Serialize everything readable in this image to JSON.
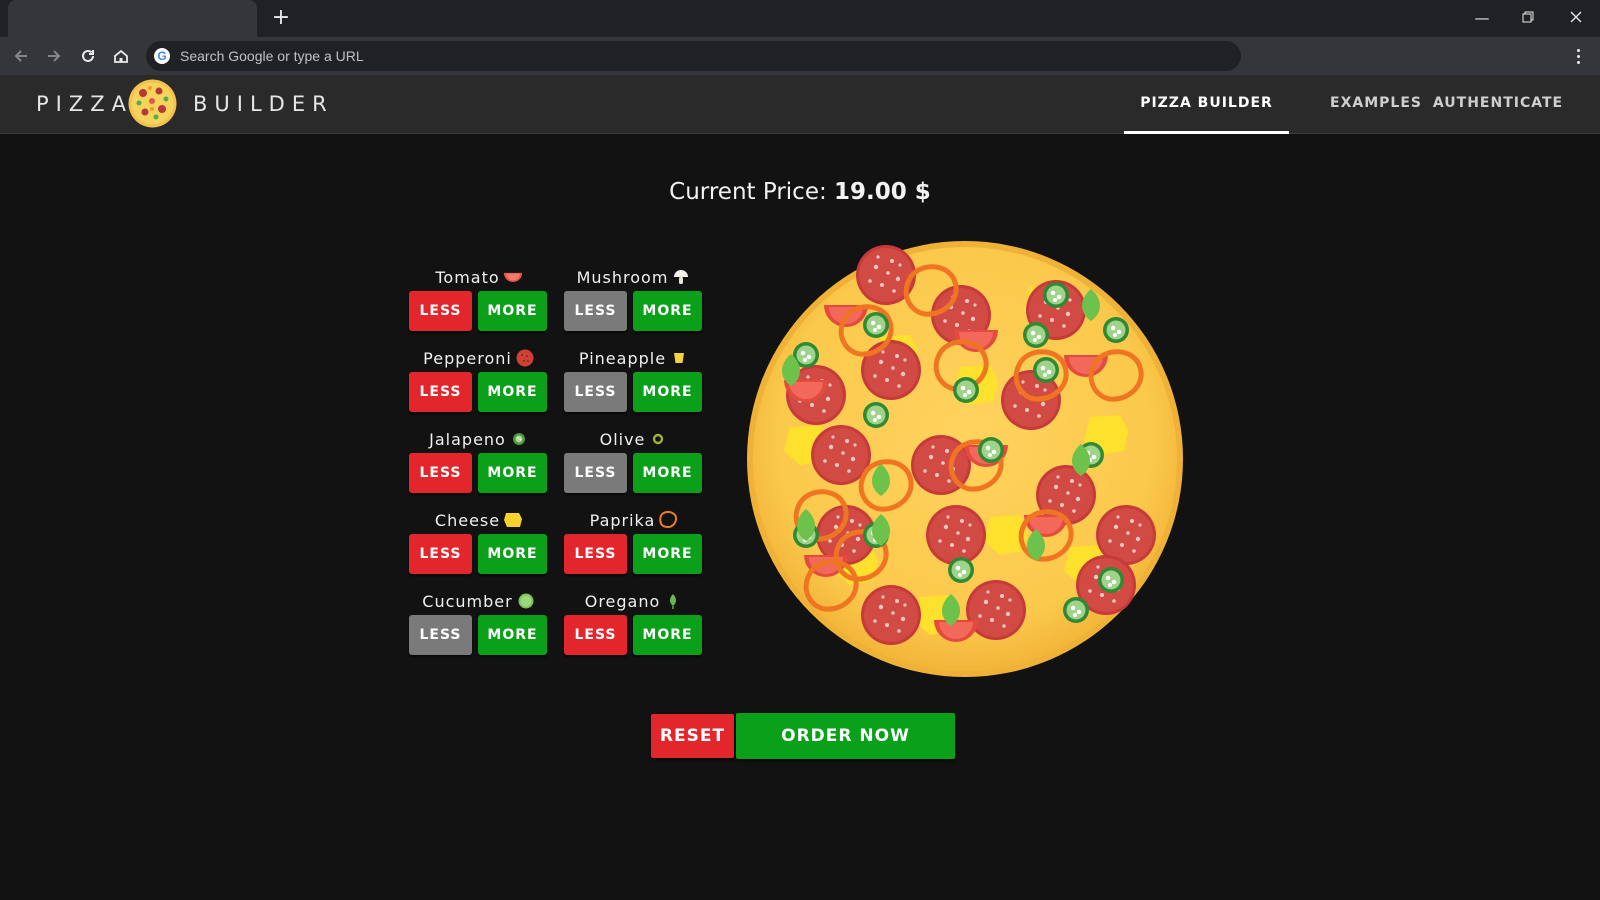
{
  "browser": {
    "new_tab_icon": "plus-icon",
    "omnibox_placeholder": "Search Google or type a URL",
    "window_controls": [
      "minimize-icon",
      "restore-icon",
      "close-icon"
    ],
    "nav_icons": [
      "back-icon",
      "forward-icon",
      "reload-icon",
      "home-icon"
    ]
  },
  "header": {
    "brand_left": "PIZZA",
    "brand_right": "BUILDER",
    "nav": [
      {
        "label": "PIZZA BUILDER",
        "active": true
      },
      {
        "label": "EXAMPLES",
        "active": false
      },
      {
        "label": "AUTHENTICATE",
        "active": false
      }
    ]
  },
  "price": {
    "label": "Current Price:",
    "value": "19.00 $"
  },
  "ingredients": [
    {
      "name": "Tomato",
      "icon": "tomato-icon",
      "less_label": "LESS",
      "more_label": "MORE",
      "less_active": true
    },
    {
      "name": "Mushroom",
      "icon": "mushroom-icon",
      "less_label": "LESS",
      "more_label": "MORE",
      "less_active": false
    },
    {
      "name": "Pepperoni",
      "icon": "pepperoni-icon",
      "less_label": "LESS",
      "more_label": "MORE",
      "less_active": true
    },
    {
      "name": "Pineapple",
      "icon": "pineapple-icon",
      "less_label": "LESS",
      "more_label": "MORE",
      "less_active": false
    },
    {
      "name": "Jalapeno",
      "icon": "jalapeno-icon",
      "less_label": "LESS",
      "more_label": "MORE",
      "less_active": true
    },
    {
      "name": "Olive",
      "icon": "olive-icon",
      "less_label": "LESS",
      "more_label": "MORE",
      "less_active": false
    },
    {
      "name": "Cheese",
      "icon": "cheese-icon",
      "less_label": "LESS",
      "more_label": "MORE",
      "less_active": true
    },
    {
      "name": "Paprika",
      "icon": "paprika-icon",
      "less_label": "LESS",
      "more_label": "MORE",
      "less_active": true
    },
    {
      "name": "Cucumber",
      "icon": "cucumber-icon",
      "less_label": "LESS",
      "more_label": "MORE",
      "less_active": false
    },
    {
      "name": "Oregano",
      "icon": "oregano-icon",
      "less_label": "LESS",
      "more_label": "MORE",
      "less_active": true
    }
  ],
  "actions": {
    "reset_label": "RESET",
    "order_label": "ORDER NOW"
  },
  "colors": {
    "less_active": "#e3262b",
    "less_disabled": "#7a7a7a",
    "more": "#0aa01a",
    "background": "#121212"
  }
}
